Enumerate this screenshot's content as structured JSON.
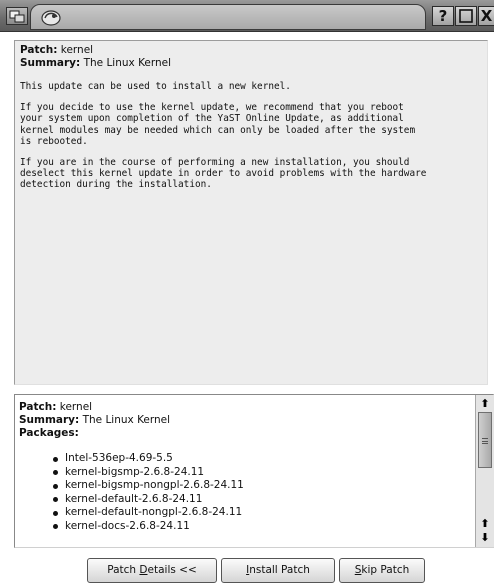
{
  "titlebar": {
    "menu_icon": "window-menu-icon",
    "logo_icon": "suse-gecko-icon",
    "help_label": "?",
    "maximize_icon": "maximize-icon",
    "close_label": "X"
  },
  "description": {
    "patch_label": "Patch:",
    "patch_value": " kernel",
    "summary_label": "Summary:",
    "summary_value": " The Linux Kernel",
    "paragraphs": [
      "This update can be used to install a new kernel.",
      "If you decide to use the kernel update, we recommend that you reboot\nyour system upon completion of the YaST Online Update, as additional\nkernel modules may be needed which can only be loaded after the system\nis rebooted.",
      "If you are in the course of performing a new installation, you should\ndeselect this kernel update in order to avoid problems with the hardware\ndetection during the installation."
    ]
  },
  "patch_list": {
    "patch_label": "Patch:",
    "patch_value": " kernel",
    "summary_label": "Summary:",
    "summary_value": " The Linux Kernel",
    "packages_label": "Packages:",
    "packages": [
      "Intel-536ep-4.69-5.5",
      "kernel-bigsmp-2.6.8-24.11",
      "kernel-bigsmp-nongpl-2.6.8-24.11",
      "kernel-default-2.6.8-24.11",
      "kernel-default-nongpl-2.6.8-24.11",
      "kernel-docs-2.6.8-24.11"
    ]
  },
  "scrollbar": {
    "up_arrow": "⬆",
    "down_arrow": "⬇"
  },
  "buttons": {
    "details_pre": "Patch ",
    "details_underlined": "D",
    "details_post": "etails <<",
    "install_underlined": "I",
    "install_post": "nstall Patch",
    "skip_underlined": "S",
    "skip_post": "kip Patch"
  }
}
